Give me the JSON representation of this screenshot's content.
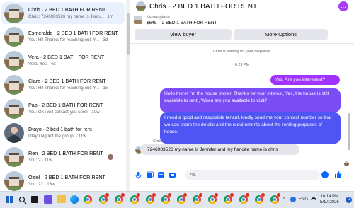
{
  "conversations": [
    {
      "title": "Chris · 2 BED 1 BATH FOR RENT",
      "preview": "Chris: 7246983526 my name is Jenn... · 1m",
      "active": true
    },
    {
      "title": "Esmeraldo · 2 BED 1 BATH FOR RENT",
      "preview": "You: Hi! Thanks for reaching out. Y... · 3d"
    },
    {
      "title": "Vera · 2 BED 1 BATH FOR RENT",
      "preview": "Vera: Yes · 4d"
    },
    {
      "title": "Clara · 2 BED 1 BATH FOR RENT",
      "preview": "You: Hi! Thanks for reaching out. Y... · 1w"
    },
    {
      "title": "Pao · 2 BED 1 BATH FOR RENT",
      "preview": "You: Ok i will contact you soon · 10w"
    },
    {
      "title": "Dtayo · 2 bed 1 bath for rent",
      "preview": "Dtayo Ng left the group. · 11w"
    },
    {
      "title": "Ren · 2 BED 1 BATH FOR RENT",
      "preview": "You: ? · 11w"
    },
    {
      "title": "Oziel · 2 BED 1 BATH FOR RENT",
      "preview": "You: ?? · 13w"
    }
  ],
  "chat": {
    "name": "Chris · 2 BED 1 BATH FOR RENT",
    "menu_label": "..."
  },
  "marketplace": {
    "label": "Marketplace",
    "price_title": "$645 – 2 BED 1 BATH FOR RENT",
    "view_buyer": "View buyer",
    "more_options": "More Options"
  },
  "messages": {
    "waiting_notice": "Chris is waiting for your response.",
    "time": "6:29 PM",
    "out1": "Yes. Are you interested?",
    "out2": "Hello there! I'm the house owner. Thanks for your interest, Yes, the house is still available to rent , When are you available to visit?",
    "out3": "I need a good and resposible tenant.  kindly send me your contact number so that we can share the details and the requirements about the renting purposes of house.",
    "sender": "Chris",
    "in1": "7246983526 my name is Jennifer and my fiancée name is chris"
  },
  "composer": {
    "placeholder": "Aa",
    "icons": [
      "mic-icon",
      "photo-icon",
      "sticker-icon",
      "gif-icon",
      "emoji-icon",
      "like-icon"
    ]
  },
  "taskbar": {
    "language": "ENG",
    "time": "10:14 PM",
    "date": "5/17/2026",
    "notifications": "14"
  },
  "colors": {
    "accent": "#0866ff",
    "bubble_purple": "#a033ff",
    "bubble_violet": "#7a4df5",
    "bubble_blue": "#4e55f2"
  }
}
